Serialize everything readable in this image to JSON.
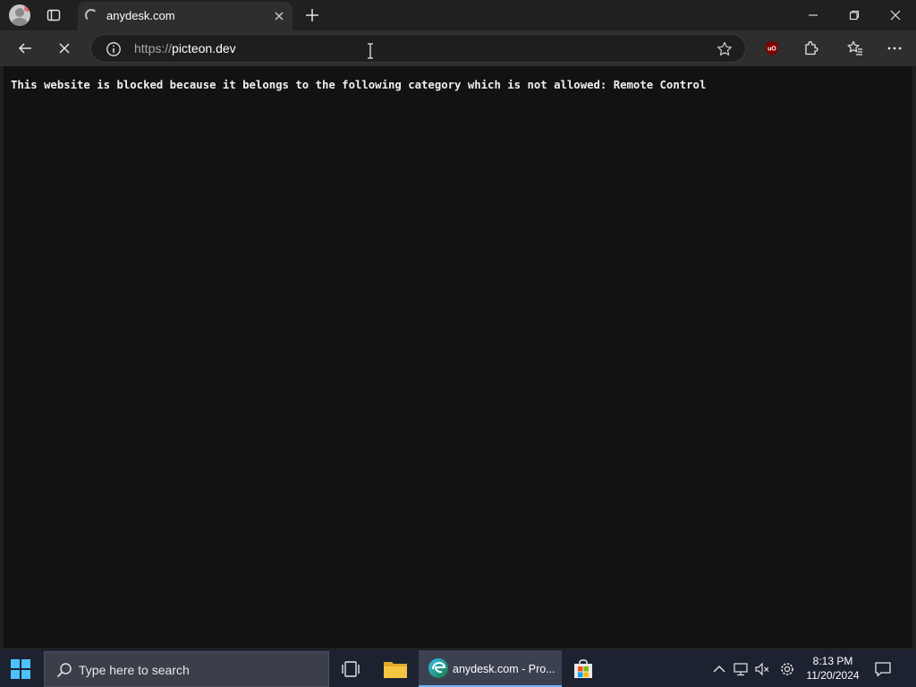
{
  "browser": {
    "tab": {
      "title": "anydesk.com"
    },
    "address_bar": {
      "scheme": "https://",
      "host": "picteon.dev"
    },
    "extension": {
      "label": "uO"
    }
  },
  "page": {
    "message": "This website is blocked because it belongs to the following category which is not allowed: Remote Control"
  },
  "taskbar": {
    "search_placeholder": "Type here to search",
    "edge_task_label": "anydesk.com - Pro...",
    "clock_time": "8:13 PM",
    "clock_date": "11/20/2024"
  },
  "colors": {
    "page_bg": "#121212",
    "chrome_bg": "#202020",
    "toolbar_bg": "#2e2e2e",
    "taskbar_bg": "#1c2230",
    "accent": "#6fb4ff",
    "ublock_red": "#800000"
  }
}
